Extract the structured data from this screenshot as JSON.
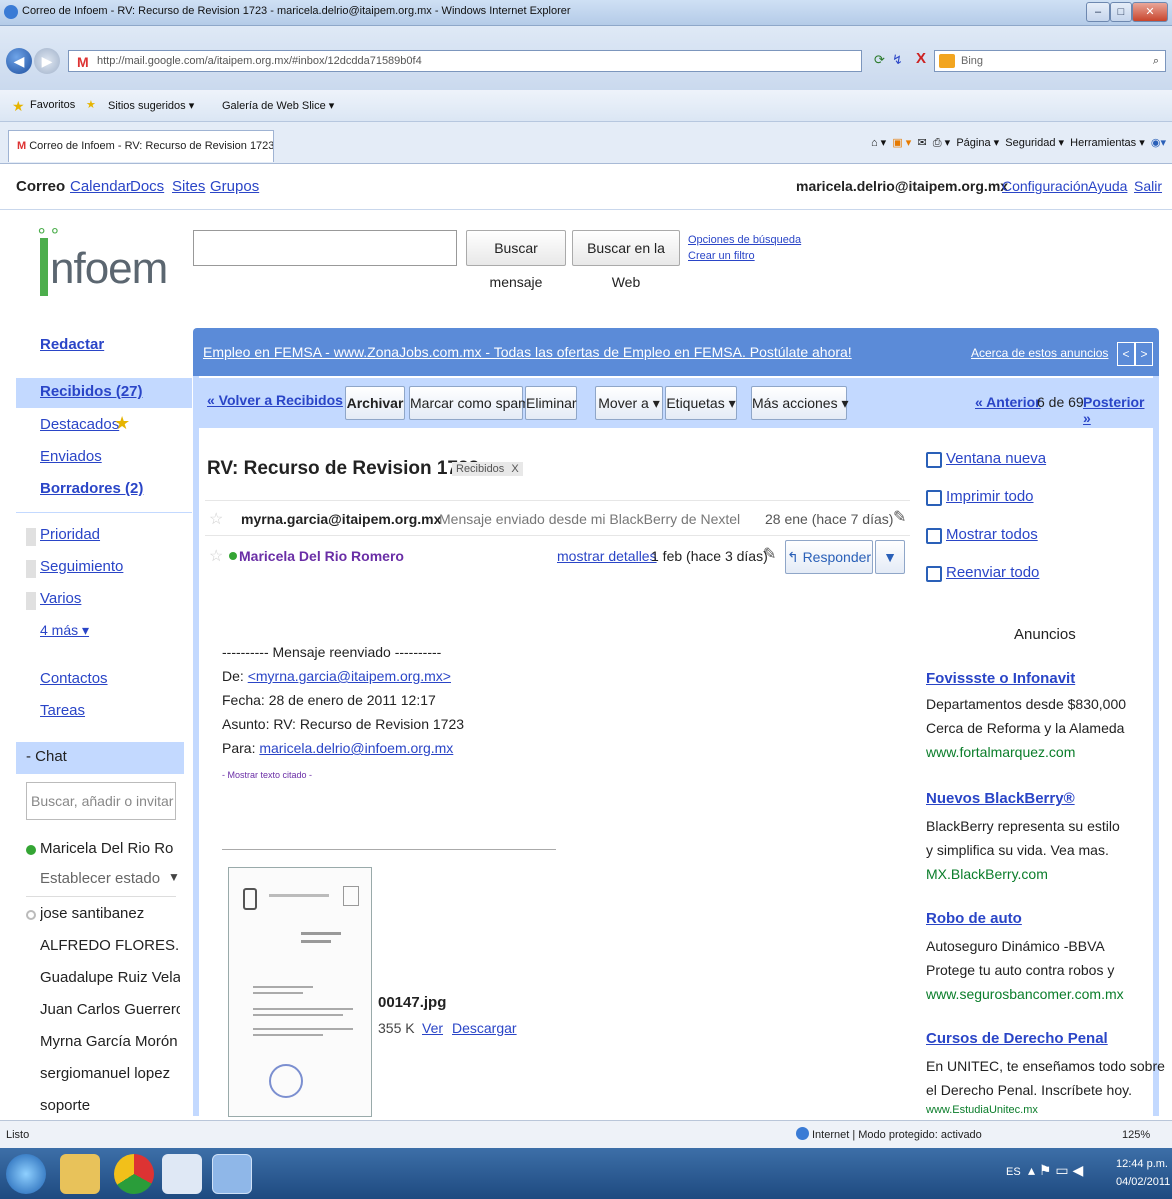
{
  "browser": {
    "window_title": "Correo de Infoem - RV: Recurso de Revision 1723 - maricela.delrio@itaipem.org.mx - Windows Internet Explorer",
    "url": "http://mail.google.com/a/itaipem.org.mx/#inbox/12dcdda71589b0f4",
    "search_engine": "Bing",
    "favorites_label": "Favoritos",
    "fav_sites": "Sitios sugeridos ▾",
    "fav_gallery": "Galería de Web Slice ▾",
    "tab_title": "Correo de Infoem - RV: Recurso de Revision 1723 ...",
    "commands": [
      "Página ▾",
      "Seguridad ▾",
      "Herramientas ▾"
    ],
    "status_left": "Listo",
    "status_zone": "Internet | Modo protegido: activado",
    "zoom": "125%",
    "clock_time": "12:44 p.m.",
    "clock_date": "04/02/2011",
    "lang": "ES"
  },
  "gmail_top": {
    "links": [
      "Correo",
      "Calendar",
      "Docs",
      "Sites",
      "Grupos"
    ],
    "user": "maricela.delrio@itaipem.org.mx",
    "settings": "Configuración",
    "help": "Ayuda",
    "signout": "Salir"
  },
  "logo_text": "nfoem",
  "search": {
    "btn_mail": "Buscar mensaje",
    "btn_web": "Buscar en la Web",
    "options": "Opciones de búsqueda",
    "filter": "Crear un filtro"
  },
  "nav": {
    "compose": "Redactar",
    "inbox": "Recibidos (27)",
    "starred": "Destacados",
    "sent": "Enviados",
    "drafts": "Borradores (2)",
    "labels": [
      "Prioridad",
      "Seguimiento",
      "Varios"
    ],
    "more": "4 más ▾",
    "contacts": "Contactos",
    "tasks": "Tareas"
  },
  "chat": {
    "header": "- Chat",
    "search_placeholder": "Buscar, añadir o invitar",
    "me": "Maricela Del Rio Ro",
    "set_status": "Establecer estado",
    "contacts": [
      "jose santibanez",
      "ALFREDO FLORES...",
      "Guadalupe Ruiz Velaz...",
      "Juan Carlos Guerrero...",
      "Myrna García Morón",
      "sergiomanuel lopez",
      "soporte"
    ]
  },
  "ad_bar": {
    "text": "Empleo en FEMSA - www.ZonaJobs.com.mx - Todas las ofertas de Empleo en FEMSA. Postúlate ahora!",
    "about": "Acerca de estos anuncios"
  },
  "actions": {
    "back": "« Volver a Recibidos",
    "archive": "Archivar",
    "spam": "Marcar como spam",
    "delete": "Eliminar",
    "move": "Mover a ▾",
    "labels": "Etiquetas ▾",
    "more": "Más acciones ▾",
    "prev": "« Anterior",
    "position": "6 de 69",
    "next": "Posterior »"
  },
  "thread": {
    "subject": "RV: Recurso de Revision 1723",
    "label_chip": "Recibidos",
    "chip_close": "X",
    "msg1_from": "myrna.garcia@itaipem.org.mx",
    "msg1_snippet": "Mensaje enviado desde mi BlackBerry de Nextel",
    "msg1_date": "28 ene (hace 7 días)",
    "msg2_from": "Maricela Del Rio Romero",
    "msg2_details": "mostrar detalles",
    "msg2_date": "1 feb (hace 3 días)",
    "reply": "Responder",
    "fwd_header": "---------- Mensaje reenviado ----------",
    "de_label": "De: ",
    "de_value": "<myrna.garcia@itaipem.org.mx>",
    "fecha": "Fecha: 28 de enero de 2011 12:17",
    "asunto": "Asunto: RV: Recurso de Revision 1723",
    "para_label": "Para: ",
    "para_value": "maricela.delrio@infoem.org.mx",
    "show_quoted": "- Mostrar texto citado -",
    "attachment_name": "00147.jpg",
    "attachment_size": "355 K",
    "view": "Ver",
    "download": "Descargar"
  },
  "side_actions": [
    "Ventana nueva",
    "Imprimir todo",
    "Mostrar todos",
    "Reenviar todo"
  ],
  "ads_header": "Anuncios",
  "ads": [
    {
      "title": "Fovissste o Infonavit",
      "lines": [
        "Departamentos desde $830,000",
        "Cerca de Reforma y la Alameda"
      ],
      "url": "www.fortalmarquez.com"
    },
    {
      "title": "Nuevos BlackBerry®",
      "lines": [
        "BlackBerry representa su estilo",
        "y simplifica su vida. Vea mas."
      ],
      "url": "MX.BlackBerry.com"
    },
    {
      "title": "Robo de auto",
      "lines": [
        "Autoseguro Dinámico -BBVA",
        "Protege tu auto contra robos y"
      ],
      "url": "www.segurosbancomer.com.mx"
    },
    {
      "title": "Cursos de Derecho Penal",
      "lines": [
        "En UNITEC, te enseñamos todo sobre",
        "el Derecho Penal. Inscríbete hoy."
      ],
      "url": "www.EstudiaUnitec.mx"
    }
  ]
}
